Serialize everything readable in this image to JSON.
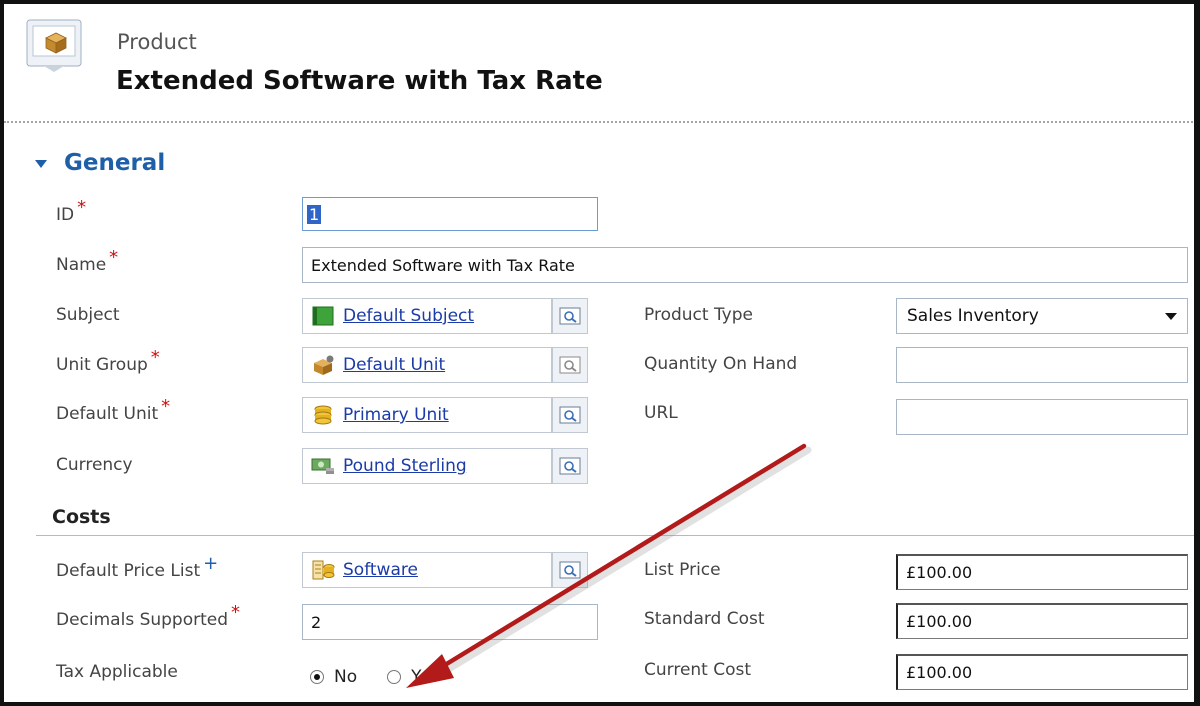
{
  "header": {
    "entity_type": "Product",
    "title": "Extended Software with Tax Rate"
  },
  "section": {
    "title": "General"
  },
  "fields": {
    "id": {
      "label": "ID",
      "value": "1",
      "required": "*"
    },
    "name": {
      "label": "Name",
      "value": "Extended Software with Tax Rate",
      "required": "*"
    },
    "subject": {
      "label": "Subject",
      "value": "Default Subject"
    },
    "unit_group": {
      "label": "Unit Group",
      "value": "Default Unit",
      "required": "*"
    },
    "default_unit": {
      "label": "Default Unit",
      "value": "Primary Unit",
      "required": "*"
    },
    "currency": {
      "label": "Currency",
      "value": "Pound Sterling"
    },
    "product_type": {
      "label": "Product Type",
      "value": "Sales Inventory"
    },
    "quantity_on_hand": {
      "label": "Quantity On Hand",
      "value": ""
    },
    "url": {
      "label": "URL",
      "value": ""
    }
  },
  "costs": {
    "title": "Costs",
    "default_price_list": {
      "label": "Default Price List",
      "value": "Software",
      "recommended": "+"
    },
    "decimals_supported": {
      "label": "Decimals Supported",
      "value": "2",
      "required": "*"
    },
    "tax_applicable": {
      "label": "Tax Applicable",
      "options": [
        "No",
        "Yes"
      ],
      "selected": "No"
    },
    "list_price": {
      "label": "List Price",
      "value": "£100.00"
    },
    "standard_cost": {
      "label": "Standard Cost",
      "value": "£100.00"
    },
    "current_cost": {
      "label": "Current Cost",
      "value": "£100.00"
    }
  },
  "colors": {
    "section_title": "#1f5fa8",
    "required_marker": "#d01010",
    "link": "#1a3ba8",
    "annotation_arrow": "#b31b1b"
  }
}
